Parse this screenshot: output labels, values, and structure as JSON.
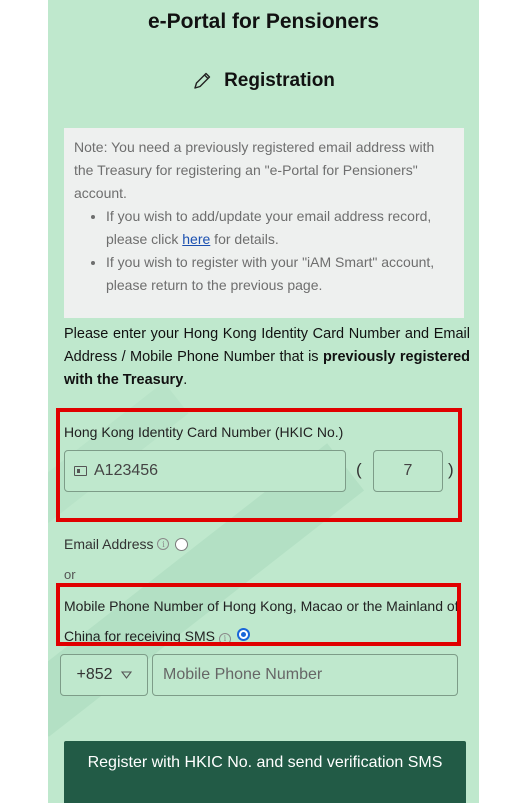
{
  "header": {
    "title": "e-Portal for Pensioners",
    "subtitle": "Registration",
    "subtitle_icon": "pencil-icon"
  },
  "note": {
    "intro": "Note: You need a previously registered email address with the Treasury for registering an \"e-Portal for Pensioners\" account.",
    "bullet1_prefix": "If you wish to add/update your email address record, please click ",
    "bullet1_link": "here",
    "bullet1_suffix": " for details.",
    "bullet2": "If you wish to register with your \"iAM Smart\" account, please return to the previous page."
  },
  "instruction": {
    "text": "Please enter your Hong Kong Identity Card Number and Email Address / Mobile Phone Number that is ",
    "bold": "previously registered with the Treasury",
    "end": "."
  },
  "hkic": {
    "label": "Hong Kong Identity Card Number (HKIC No.)",
    "value": "A123456",
    "check_digit": "7",
    "open_paren": "(",
    "close_paren": ")"
  },
  "email_option": {
    "label": "Email Address",
    "selected": false
  },
  "or_text": "or",
  "mobile_option": {
    "label": "Mobile Phone Number of Hong Kong, Macao or the Mainland of China for receiving SMS",
    "selected": true
  },
  "country_code": {
    "value": "+852",
    "options_icon": "triangle-down-icon"
  },
  "mobile_input": {
    "placeholder": "Mobile Phone Number"
  },
  "submit": {
    "label": "Register with HKIC No. and send verification SMS"
  },
  "colors": {
    "panel": "#bfe8cd",
    "button": "#225b46",
    "highlight": "#e00000",
    "link": "#1a4fb0",
    "radio": "#1a66d9"
  }
}
